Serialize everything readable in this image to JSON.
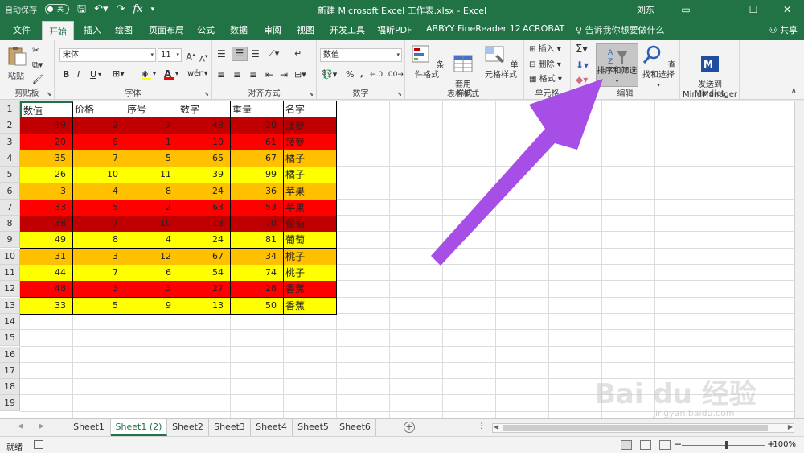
{
  "titlebar": {
    "autosave_label": "自动保存",
    "autosave_state": "关",
    "save_icon": "floppy-disk-icon",
    "undo_icon": "undo-icon",
    "fx_icon": "fx",
    "title": "新建 Microsoft Excel 工作表.xlsx  -  Excel",
    "user": "刘东",
    "window_buttons": [
      "▭",
      "—",
      "☐",
      "✕"
    ]
  },
  "tabs": [
    "文件",
    "开始",
    "插入",
    "绘图",
    "页面布局",
    "公式",
    "数据",
    "审阅",
    "视图",
    "开发工具",
    "福昕PDF",
    "ABBYY FineReader 12",
    "ACROBAT"
  ],
  "active_tab": "开始",
  "tellme": "告诉我你想要做什么",
  "share": "共享",
  "ribbon": {
    "clipboard": {
      "paste": "粘贴",
      "label": "剪贴板"
    },
    "font": {
      "name": "宋体",
      "size": "11",
      "bold": "B",
      "italic": "I",
      "underline": "U",
      "grow": "A",
      "shrink": "A",
      "label": "字体"
    },
    "alignment": {
      "label": "对齐方式"
    },
    "number": {
      "format": "数值",
      "label": "数字"
    },
    "styles": {
      "conditional": "条件格式",
      "table": "套用\n表格格式",
      "cell": "单元格样式",
      "label": "样式"
    },
    "cells": {
      "insert": "插入",
      "delete": "删除",
      "format": "格式",
      "label": "单元格"
    },
    "editing": {
      "sort": "排序和筛选",
      "find": "查找和选择",
      "label": "编辑"
    },
    "mindjet": {
      "send": "发送到\nMindManager",
      "label": "Mindjet"
    }
  },
  "columns_visible": 15,
  "rows_visible": 19,
  "table": {
    "headers": [
      "数值",
      "价格",
      "序号",
      "数字",
      "重量",
      "名字"
    ],
    "rows": [
      [
        19,
        2,
        7,
        43,
        20,
        "菠萝"
      ],
      [
        20,
        6,
        1,
        10,
        61,
        "菠萝"
      ],
      [
        35,
        7,
        5,
        65,
        67,
        "橘子"
      ],
      [
        26,
        10,
        11,
        39,
        99,
        "橘子"
      ],
      [
        3,
        4,
        8,
        24,
        36,
        "苹果"
      ],
      [
        33,
        5,
        2,
        63,
        53,
        "苹果"
      ],
      [
        38,
        7,
        10,
        13,
        70,
        "葡萄"
      ],
      [
        49,
        8,
        4,
        24,
        81,
        "葡萄"
      ],
      [
        31,
        3,
        12,
        67,
        34,
        "桃子"
      ],
      [
        44,
        7,
        6,
        54,
        74,
        "桃子"
      ],
      [
        48,
        3,
        3,
        27,
        28,
        "香蕉"
      ],
      [
        33,
        5,
        9,
        13,
        50,
        "香蕉"
      ]
    ],
    "row_colors": [
      "#c00000",
      "#ff0000",
      "#ffc000",
      "#ffff00",
      "#ffc000",
      "#ff0000",
      "#c00000",
      "#ffff00",
      "#ffc000",
      "#ffff00",
      "#ff0000",
      "#ffff00"
    ]
  },
  "sheets": [
    "Sheet1",
    "Sheet1 (2)",
    "Sheet2",
    "Sheet3",
    "Sheet4",
    "Sheet5",
    "Sheet6"
  ],
  "active_sheet": "Sheet1 (2)",
  "status": {
    "ready": "就绪",
    "zoom": "100%"
  },
  "watermark": {
    "main": "Bai du 经验",
    "sub": "jingyan.baidu.com"
  },
  "colors": {
    "excel_green": "#217346",
    "arrow": "#a64ee6"
  }
}
